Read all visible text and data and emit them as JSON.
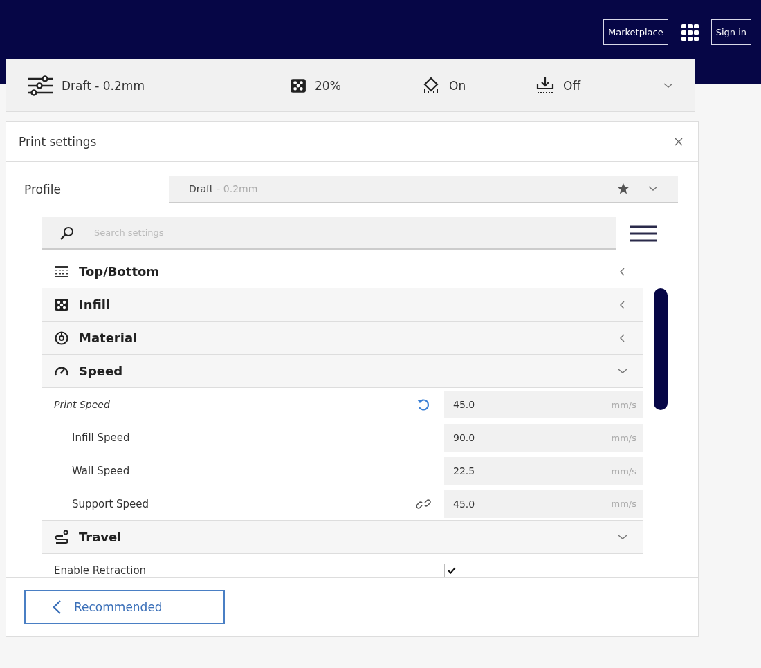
{
  "header": {
    "marketplace_button": "Marketplace",
    "sign_in_button": "Sign in"
  },
  "toolbar": {
    "profile": "Draft - 0.2mm",
    "infill": "20%",
    "support": "On",
    "adhesion": "Off"
  },
  "panel": {
    "title": "Print settings",
    "profile": {
      "label": "Profile",
      "name": "Draft",
      "detail": "- 0.2mm",
      "favorite": true
    },
    "search": {
      "placeholder": "Search settings"
    },
    "categories": [
      {
        "label": "Top/Bottom",
        "expanded": false
      },
      {
        "label": "Infill",
        "expanded": false
      },
      {
        "label": "Material",
        "expanded": false
      },
      {
        "label": "Speed",
        "expanded": true,
        "children": [
          {
            "kind": "value",
            "label": "Print Speed",
            "value": "45.0",
            "unit": "mm/s",
            "modified": true,
            "linked": false,
            "children": [
              {
                "kind": "value",
                "label": "Infill Speed",
                "value": "90.0",
                "unit": "mm/s",
                "modified": false,
                "linked": false
              },
              {
                "kind": "value",
                "label": "Wall Speed",
                "value": "22.5",
                "unit": "mm/s",
                "modified": false,
                "linked": false
              },
              {
                "kind": "value",
                "label": "Support Speed",
                "value": "45.0",
                "unit": "mm/s",
                "modified": false,
                "linked": true
              }
            ]
          }
        ]
      },
      {
        "label": "Travel",
        "expanded": true,
        "children": [
          {
            "kind": "checkbox",
            "label": "Enable Retraction",
            "checked": true
          }
        ]
      }
    ],
    "footer_button": "Recommended"
  }
}
